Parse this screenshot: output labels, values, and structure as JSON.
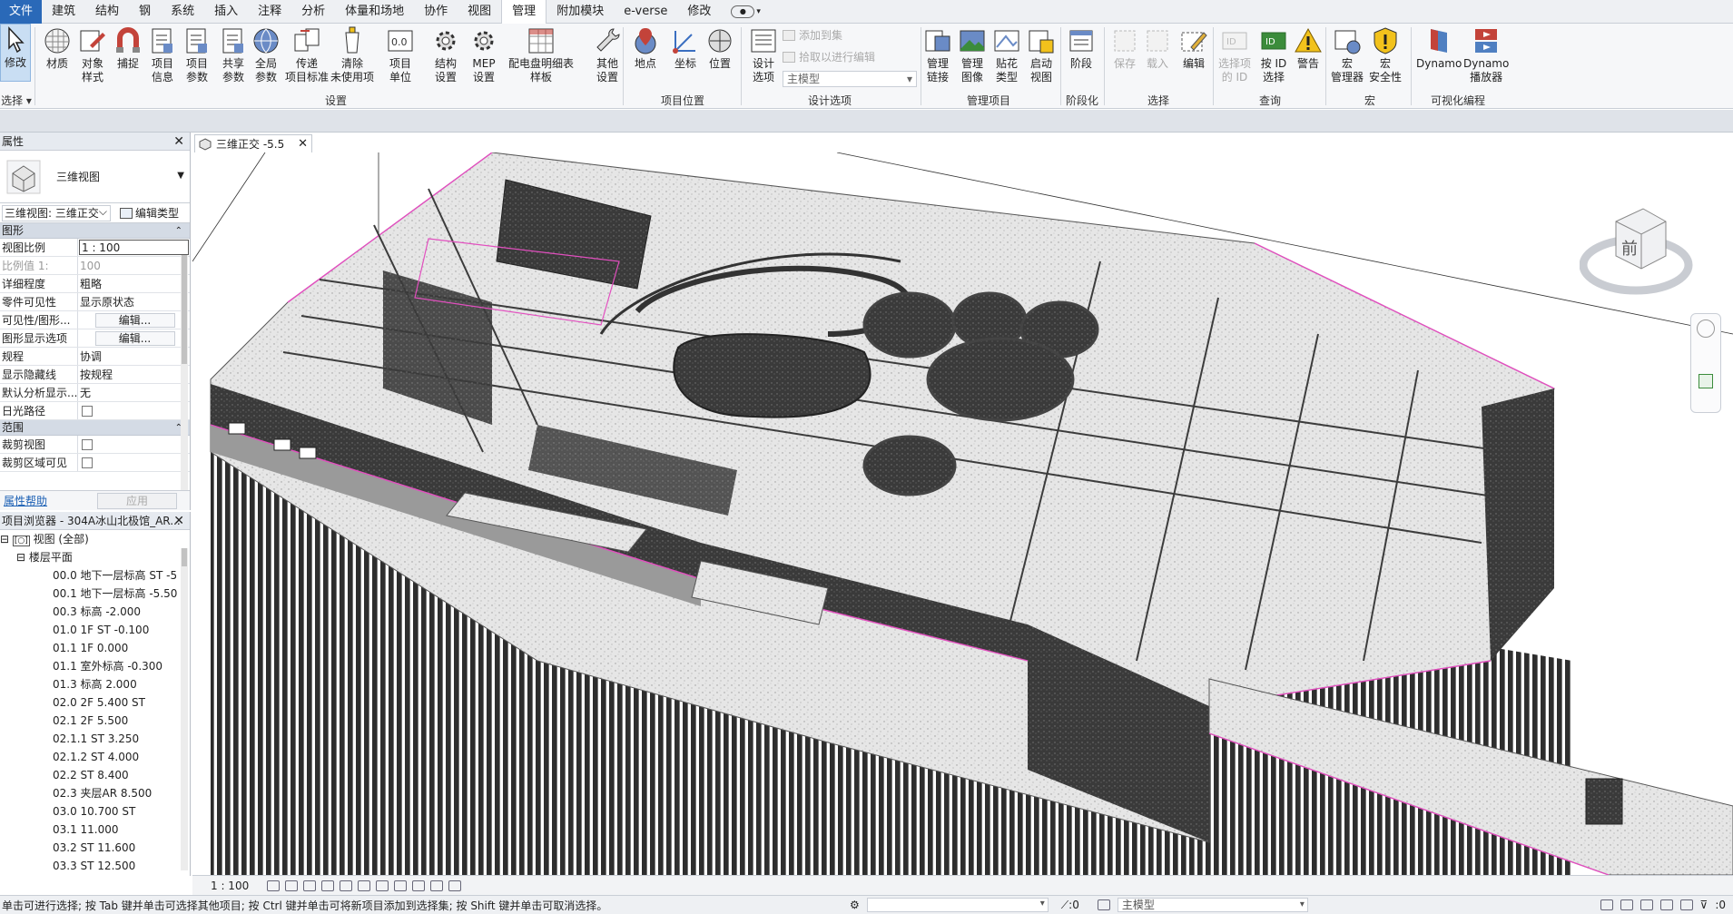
{
  "menu": {
    "tabs": [
      "文件",
      "建筑",
      "结构",
      "钢",
      "系统",
      "插入",
      "注释",
      "分析",
      "体量和场地",
      "协作",
      "视图",
      "管理",
      "附加模块",
      "e-verse",
      "修改"
    ],
    "active_tab": "管理"
  },
  "ribbon": {
    "modify": "修改",
    "select_panel": "选择",
    "settings_buttons": [
      {
        "l1": "材质",
        "l2": ""
      },
      {
        "l1": "对象",
        "l2": "样式"
      },
      {
        "l1": "捕捉",
        "l2": ""
      },
      {
        "l1": "项目",
        "l2": "信息"
      },
      {
        "l1": "项目",
        "l2": "参数"
      },
      {
        "l1": "共享",
        "l2": "参数"
      },
      {
        "l1": "全局",
        "l2": "参数"
      },
      {
        "l1": "传递",
        "l2": "项目标准"
      },
      {
        "l1": "清除",
        "l2": "未使用项"
      },
      {
        "l1": "项目",
        "l2": "单位"
      },
      {
        "l1": "结构",
        "l2": "设置"
      },
      {
        "l1": "MEP",
        "l2": "设置"
      },
      {
        "l1": "配电盘明细表",
        "l2": "样板"
      },
      {
        "l1": "其他",
        "l2": "设置"
      }
    ],
    "settings_panel": "设置",
    "location_buttons": [
      {
        "l1": "地点"
      },
      {
        "l1": "坐标"
      },
      {
        "l1": "位置"
      }
    ],
    "location_panel": "项目位置",
    "design_options": {
      "btn_l1": "设计",
      "btn_l2": "选项",
      "add_to_set": "添加到集",
      "pick_to_edit": "拾取以进行编辑",
      "dropdown": "主模型",
      "panel": "设计选项"
    },
    "manage_project": [
      {
        "l1": "管理",
        "l2": "链接"
      },
      {
        "l1": "管理",
        "l2": "图像"
      },
      {
        "l1": "贴花",
        "l2": "类型"
      },
      {
        "l1": "启动",
        "l2": "视图"
      }
    ],
    "manage_project_panel": "管理项目",
    "phasing": {
      "btn": "阶段",
      "panel": "阶段化"
    },
    "selection": {
      "save": "保存",
      "load": "载入",
      "edit": "编辑",
      "panel": "选择"
    },
    "inquiry": {
      "ids_l1": "选择项",
      "ids_l2": "的 ID",
      "byid_l1": "按 ID",
      "byid_l2": "选择",
      "warn": "警告",
      "panel": "查询"
    },
    "macros": {
      "mgr_l1": "宏",
      "mgr_l2": "管理器",
      "sec_l1": "宏",
      "sec_l2": "安全性",
      "panel": "宏"
    },
    "visual_programming": {
      "dynamo": "Dynamo",
      "player_l1": "Dynamo",
      "player_l2": "播放器",
      "panel": "可视化编程"
    }
  },
  "properties": {
    "title": "属性",
    "type_name": "三维视图",
    "view_selector": "三维视图: 三维正交",
    "edit_type": "编辑类型",
    "section_graphics": "图形",
    "rows": [
      {
        "k": "视图比例",
        "v": "1 : 100",
        "kind": "input"
      },
      {
        "k": "比例值 1:",
        "v": "100",
        "kind": "grey"
      },
      {
        "k": "详细程度",
        "v": "粗略",
        "kind": "text"
      },
      {
        "k": "零件可见性",
        "v": "显示原状态",
        "kind": "text"
      },
      {
        "k": "可见性/图形...",
        "v": "编辑...",
        "kind": "button"
      },
      {
        "k": "图形显示选项",
        "v": "编辑...",
        "kind": "button"
      },
      {
        "k": "规程",
        "v": "协调",
        "kind": "text"
      },
      {
        "k": "显示隐藏线",
        "v": "按规程",
        "kind": "text"
      },
      {
        "k": "默认分析显示...",
        "v": "无",
        "kind": "text"
      },
      {
        "k": "日光路径",
        "v": "",
        "kind": "check"
      }
    ],
    "section_extents": "范围",
    "rows2": [
      {
        "k": "裁剪视图",
        "v": "",
        "kind": "check"
      },
      {
        "k": "裁剪区域可见",
        "v": "",
        "kind": "check"
      }
    ],
    "help_link": "属性帮助",
    "apply": "应用"
  },
  "browser": {
    "title": "项目浏览器 - 304A冰山北极馆_AR...",
    "root": "视图 (全部)",
    "group": "楼层平面",
    "items": [
      "00.0 地下一层标高 ST -5",
      "00.1 地下一层标高 -5.50",
      "00.3 标高 -2.000",
      "01.0 1F ST -0.100",
      "01.1 1F 0.000",
      "01.1 室外标高 -0.300",
      "01.3 标高 2.000",
      "02.0 2F 5.400 ST",
      "02.1 2F 5.500",
      "02.1.1 ST 3.250",
      "02.1.2 ST 4.000",
      "02.2 ST 8.400",
      "02.3 夹层AR 8.500",
      "03.0 10.700 ST",
      "03.1 11.000",
      "03.2 ST 11.600",
      "03.3 ST 12.500"
    ]
  },
  "view": {
    "tab_title": "三维正交 -5.5",
    "cube_face": "前",
    "scale": "1 : 100"
  },
  "statusbar": {
    "message": "单击可进行选择; 按 Tab 键并单击可选择其他项目; 按 Ctrl 键并单击可将新项目添加到选择集; 按 Shift 键并单击可取消选择。",
    "worksets": ":0",
    "model": "主模型",
    "filter_count": ":0"
  },
  "colors": {
    "accent": "#2a69b8",
    "pink": "#e24fbf",
    "concrete": "#e8e8e8",
    "dark": "#303030"
  }
}
